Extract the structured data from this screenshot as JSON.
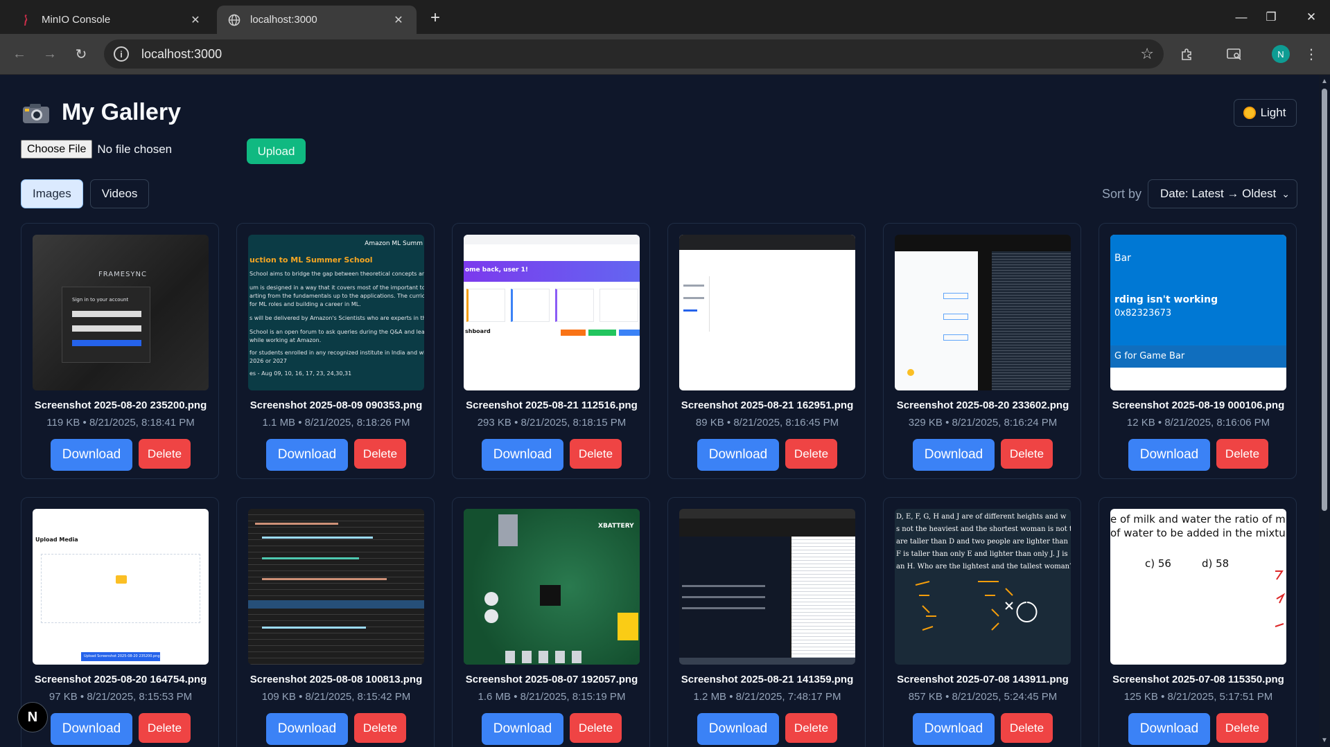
{
  "browser": {
    "tabs": [
      {
        "title": "MinIO Console",
        "active": false,
        "icon": "minio-flamingo-icon"
      },
      {
        "title": "localhost:3000",
        "active": true,
        "icon": "globe-icon"
      }
    ],
    "url": "localhost:3000",
    "profile_initial": "N"
  },
  "header": {
    "title": "My Gallery",
    "theme_toggle_label": "Light"
  },
  "upload": {
    "choose_file_label": "Choose File",
    "no_file_text": "No file chosen",
    "upload_label": "Upload"
  },
  "media_tabs": [
    {
      "label": "Images",
      "active": true
    },
    {
      "label": "Videos",
      "active": false
    }
  ],
  "sort": {
    "label": "Sort by",
    "selected": "Date: Latest → Oldest"
  },
  "actions": {
    "download_label": "Download",
    "delete_label": "Delete"
  },
  "images": [
    {
      "name": "Screenshot 2025-08-20 235200.png",
      "meta": "119 KB • 8/21/2025, 8:18:41 PM"
    },
    {
      "name": "Screenshot 2025-08-09 090353.png",
      "meta": "1.1 MB • 8/21/2025, 8:18:26 PM"
    },
    {
      "name": "Screenshot 2025-08-21 112516.png",
      "meta": "293 KB • 8/21/2025, 8:18:15 PM"
    },
    {
      "name": "Screenshot 2025-08-21 162951.png",
      "meta": "89 KB • 8/21/2025, 8:16:45 PM"
    },
    {
      "name": "Screenshot 2025-08-20 233602.png",
      "meta": "329 KB • 8/21/2025, 8:16:24 PM"
    },
    {
      "name": "Screenshot 2025-08-19 000106.png",
      "meta": "12 KB • 8/21/2025, 8:16:06 PM"
    },
    {
      "name": "Screenshot 2025-08-20 164754.png",
      "meta": "97 KB • 8/21/2025, 8:15:53 PM"
    },
    {
      "name": "Screenshot 2025-08-08 100813.png",
      "meta": "109 KB • 8/21/2025, 8:15:42 PM"
    },
    {
      "name": "Screenshot 2025-08-07 192057.png",
      "meta": "1.6 MB • 8/21/2025, 8:15:19 PM"
    },
    {
      "name": "Screenshot 2025-08-21 141359.png",
      "meta": "1.2 MB • 8/21/2025, 7:48:17 PM"
    },
    {
      "name": "Screenshot 2025-07-08 143911.png",
      "meta": "857 KB • 8/21/2025, 5:24:45 PM"
    },
    {
      "name": "Screenshot 2025-07-08 115350.png",
      "meta": "125 KB • 8/21/2025, 5:17:51 PM"
    }
  ],
  "thumb_text": {
    "t1_brand": "FRAMESYNC",
    "t1_signin": "Sign in to your account",
    "t2_header": "Amazon ML Summ",
    "t2_title": "uction to ML Summer School",
    "t2_l1": "School aims to bridge the gap between theoretical concepts and their appl",
    "t2_l2": "um is designed in a way that it covers most of the important topics in Machi",
    "t2_l3": "arting from the fundamentals up to the applications. The curriculum will bo",
    "t2_l4": "for ML roles and building a career in ML.",
    "t2_l5": "s will be delivered by Amazon's Scientists who are experts in their respective",
    "t2_l6": "School is an open forum to ask queries during the Q&A and learn through l",
    "t2_l7": "while working at Amazon.",
    "t2_l8": "for students enrolled in any recognized institute in India and who are expe",
    "t2_l9": "2026 or 2027",
    "t2_l10": "es - Aug 09, 10, 16, 17, 23, 24,30,31",
    "t3_welcome": "ome back, user 1!",
    "t3_dash": "shboard",
    "t6_title": "Bar",
    "t6_msg": "rding isn't working",
    "t6_code": "0x82323673",
    "t6_footer": "G for Game Bar",
    "t7_title": "Upload Media",
    "t7_btn": "Upload Screenshot 2025-08-20 235200.png",
    "t9_logo": "XBATTERY",
    "t11_l1": "D, E, F, G, H and J are of different heights and w",
    "t11_l2": "s not the heaviest and the shortest woman is not t",
    "t11_l3": "are taller than D and two people are lighter than",
    "t11_l4": "F is taller than only E and lighter than only J. J is",
    "t11_l5": "an H. Who are the lightest and the tallest woman?",
    "t12_l1": "e of milk and water the ratio of mil",
    "t12_l2": "of water to be added in the mixtur",
    "t12_c": "c) 56",
    "t12_d": "d) 58"
  },
  "floating_badge": "N"
}
